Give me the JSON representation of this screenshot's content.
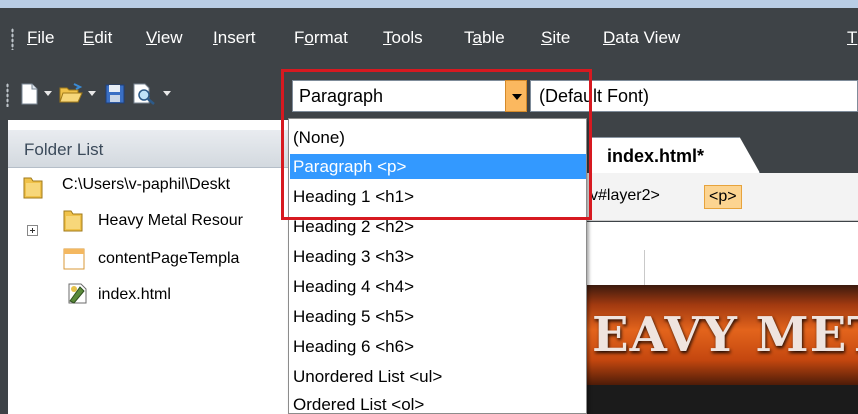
{
  "menu": {
    "items": [
      {
        "label_ul": "F",
        "label_rest": "ile"
      },
      {
        "label_ul": "E",
        "label_rest": "dit"
      },
      {
        "label_ul": "V",
        "label_rest": "iew"
      },
      {
        "label_ul": "I",
        "label_rest": "nsert"
      },
      {
        "label_pre": "F",
        "label_ul": "o",
        "label_rest": "rmat"
      },
      {
        "label_ul": "T",
        "label_rest": "ools"
      },
      {
        "label_pre": "T",
        "label_ul": "a",
        "label_rest": "ble"
      },
      {
        "label_ul": "S",
        "label_rest": "ite"
      },
      {
        "label_ul": "D",
        "label_rest": "ata View"
      },
      {
        "label_ul": "T",
        "label_rest": ""
      }
    ]
  },
  "toolbar": {
    "style_value": "Paragraph",
    "font_value": "(Default Font)"
  },
  "folder_list": {
    "title": "Folder List",
    "root_path": "C:\\Users\\v-paphil\\Deskt",
    "items": [
      {
        "label": "Heavy Metal Resour",
        "icon": "folder-icon"
      },
      {
        "label": "contentPageTempla",
        "icon": "template-page-icon"
      },
      {
        "label": "index.html",
        "icon": "html-file-icon"
      }
    ]
  },
  "editor": {
    "tab_label": "index.html*",
    "tag_crumbs": [
      "v#layer2>",
      "<p>"
    ],
    "banner_text": "EAVY MET"
  },
  "style_dropdown": {
    "options": [
      "(None)",
      "Paragraph <p>",
      "Heading 1 <h1>",
      "Heading 2 <h2>",
      "Heading 3 <h3>",
      "Heading 4 <h4>",
      "Heading 5 <h5>",
      "Heading 6 <h6>",
      "Unordered List <ul>",
      "Ordered List <ol>"
    ],
    "selected": "Paragraph <p>"
  },
  "colors": {
    "chrome": "#3e4347",
    "selection": "#3399ff",
    "highlight": "#d71920",
    "combo_button": "#fbb85f"
  }
}
